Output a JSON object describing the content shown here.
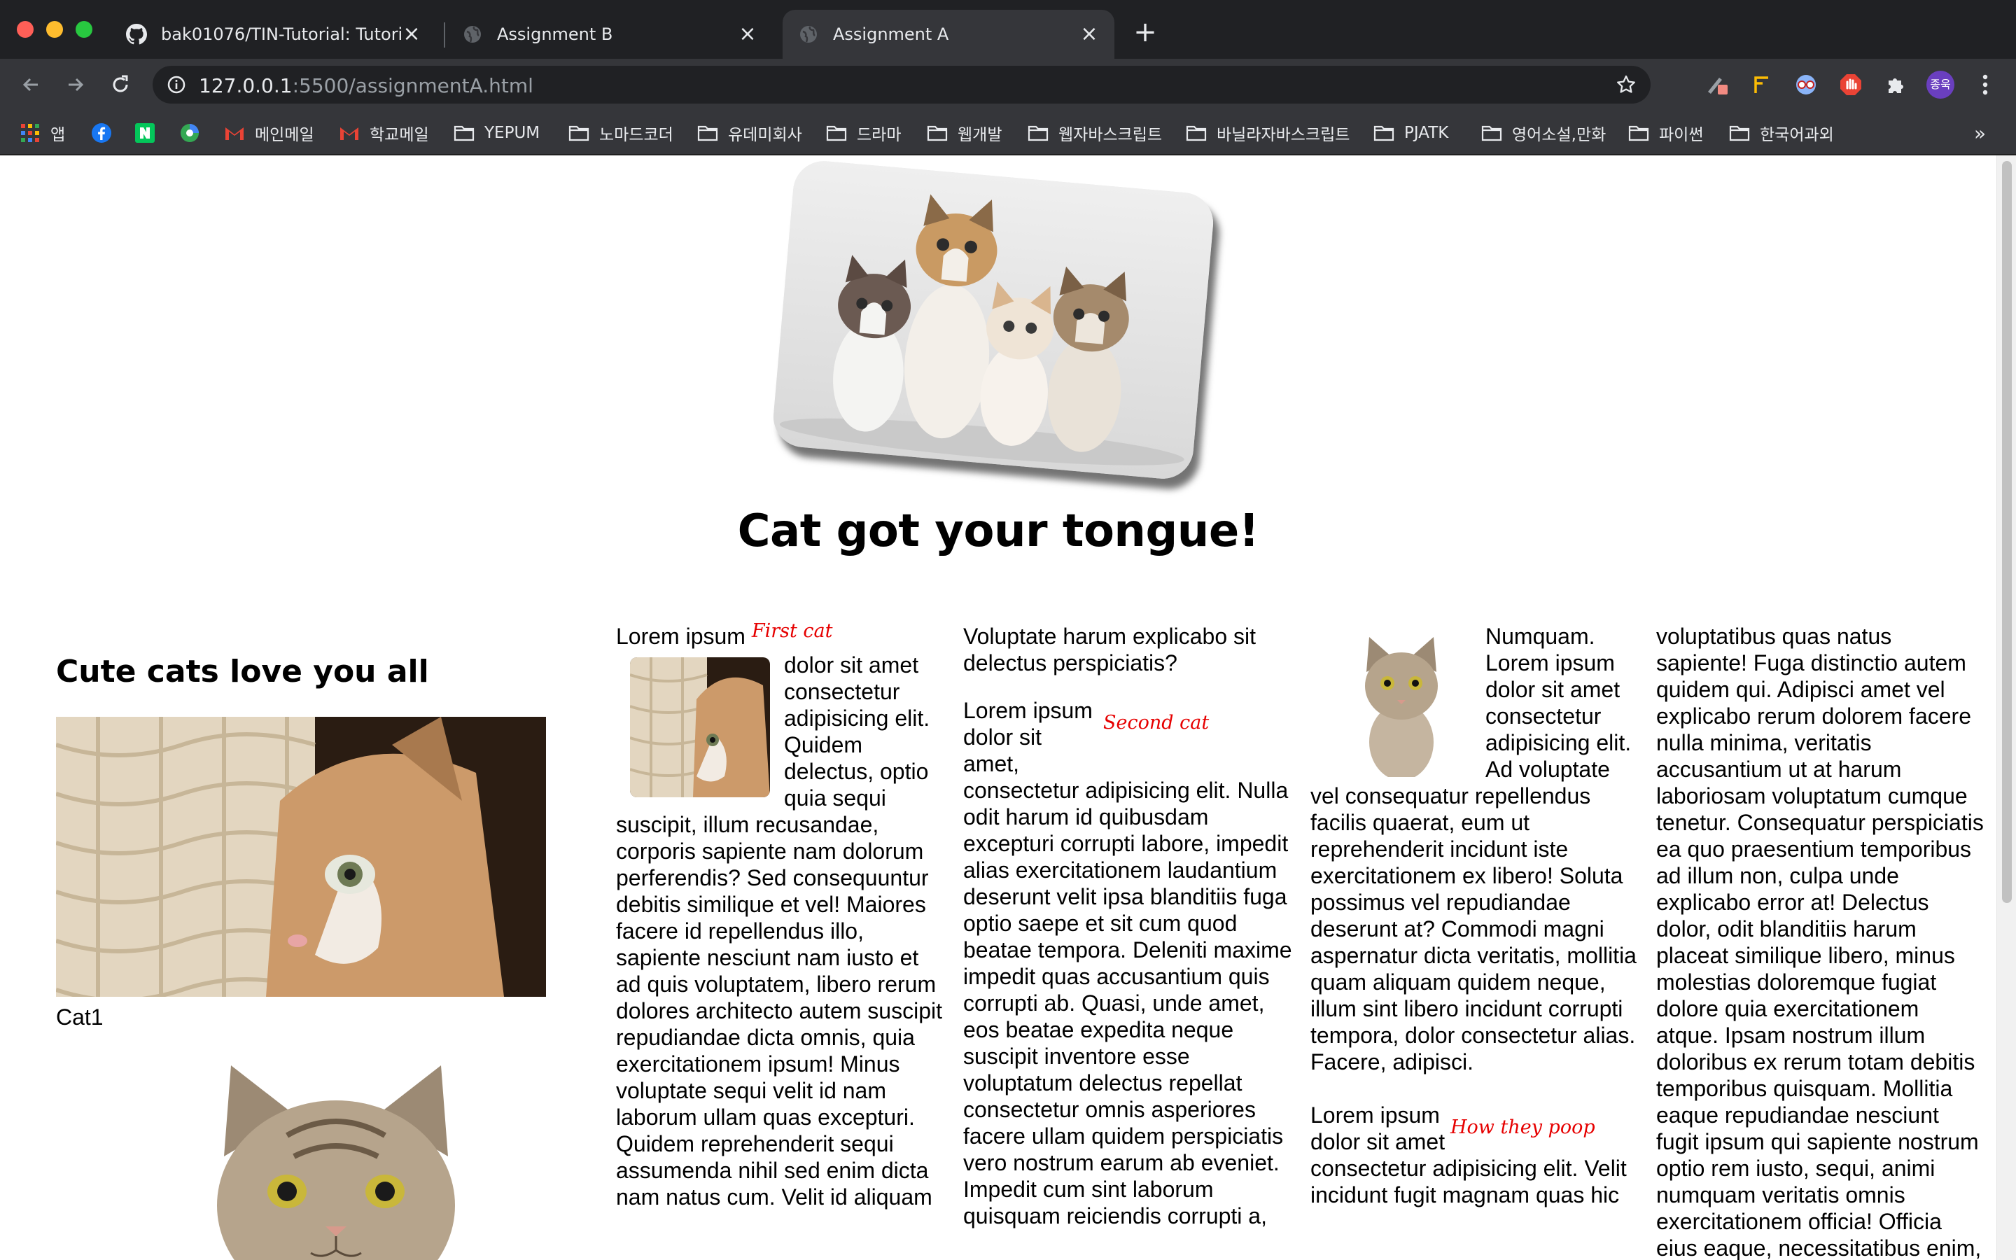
{
  "tabs": [
    {
      "label": "bak01076/TIN-Tutorial: Tutorial",
      "icon": "github-icon"
    },
    {
      "label": "Assignment B",
      "icon": "globe-icon"
    },
    {
      "label": "Assignment A",
      "icon": "globe-icon",
      "active": true
    }
  ],
  "address": {
    "host": "127.0.0.1",
    "path": ":5500/assignmentA.html"
  },
  "profile_label": "종욱",
  "bookmarks": [
    "앱",
    "메인메일",
    "학교메일",
    "YEPUM",
    "노마드코더",
    "유데미회사",
    "드라마",
    "웹개발",
    "웹자바스크립트",
    "바닐라자바스크립트",
    "PJATK",
    "영어소설,만화",
    "파이썬",
    "한국어과외"
  ],
  "more_bookmarks": "»",
  "page": {
    "title": "Cat got your tongue!",
    "sidebar_heading": "Cute cats love you all",
    "cat1_caption": "Cat1",
    "col1": {
      "lead": "Lorem ipsum",
      "caption": "First cat",
      "body": "dolor sit amet consectetur adipisicing elit. Quidem delectus, optio quia sequi suscipit, illum recusandae, corporis sapiente nam dolorum perferendis? Sed consequuntur debitis similique et vel! Maiores facere id repellendus illo, sapiente nesciunt nam iusto et ad quis voluptatem, libero rerum dolores architecto autem suscipit repudiandae dicta omnis, quia exercitationem ipsum! Minus voluptate sequi velit id nam laborum ullam quas excepturi. Quidem reprehenderit sequi assumenda nihil sed enim dicta nam natus cum. Velit id aliquam"
    },
    "col2": {
      "intro": "Voluptate harum explicabo sit delectus perspiciatis?",
      "lead": "Lorem ipsum dolor sit amet,",
      "caption": "Second cat",
      "body": "consectetur adipisicing elit. Nulla odit harum id quibusdam excepturi corrupti labore, impedit alias exercitationem laudantium deserunt velit ipsa blanditiis fuga optio saepe et sit cum quod beatae tempora. Deleniti maxime impedit quas accusantium quis corrupti ab. Quasi, unde amet, eos beatae expedita neque suscipit inventore esse voluptatum delectus repellat consectetur omnis asperiores facere ullam quidem perspiciatis vero nostrum earum ab eveniet. Impedit cum sint laborum quisquam reiciendis corrupti a,"
    },
    "col3": {
      "body": "Numquam. Lorem ipsum dolor sit amet consectetur adipisicing elit. Ad voluptate vel consequatur repellendus facilis quaerat, eum ut reprehenderit incidunt iste exercitationem ex libero! Soluta possimus vel repudiandae deserunt at? Commodi magni aspernatur dicta veritatis, mollitia quam aliquam quidem neque, illum sint libero incidunt corrupti tempora, dolor consectetur alias. Facere, adipisci.",
      "lead": "Lorem ipsum dolor sit amet",
      "caption": "How they poop",
      "body2": "consectetur adipisicing elit. Velit incidunt fugit magnam quas hic"
    },
    "col4": {
      "body": "voluptatibus quas natus sapiente! Fuga distinctio autem quidem qui. Adipisci amet vel explicabo rerum dolorem facere nulla minima, veritatis accusantium ut at harum laboriosam voluptatum cumque tenetur. Consequatur perspiciatis ea quo praesentium temporibus ad illum non, culpa unde explicabo error at! Delectus dolor, odit blanditiis harum placeat similique libero, minus molestias doloremque fugiat dolore quia exercitationem atque. Ipsam nostrum illum doloribus ex rerum totam debitis temporibus quisquam. Mollitia eaque repudiandae nesciunt fugit ipsum qui sapiente nostrum optio rem iusto, sequi, animi numquam veritatis omnis exercitationem officia! Officia eius eaque, necessitatibus enim,"
    }
  },
  "colors": {
    "chrome_dark": "#202124",
    "chrome_toolbar": "#35363a",
    "chrome_text": "#e8eaed",
    "caption_red": "#e60000",
    "page_bg": "#ffffff"
  }
}
